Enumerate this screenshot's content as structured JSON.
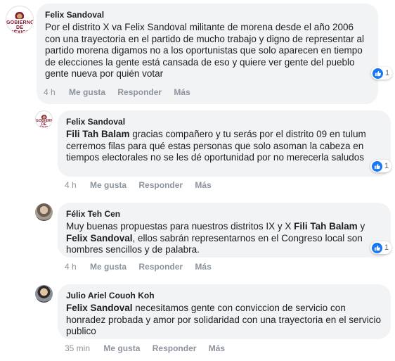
{
  "comments": [
    {
      "author": "Felix Sandoval",
      "avatar_text": "GOBIERNO DE MÉXICO",
      "text": "Por el distrito X va Felix Sandoval militante de morena desde el año 2006 con una trayectoria en el partido de mucho trabajo y digno de representar al partido morena digamos no a los oportunistas que solo aparecen en tiempo de elecciones la gente está cansada de eso y quiere ver gente del pueblo gente nueva por quién votar",
      "reaction_count": "1",
      "time": "4 h",
      "like_label": "Me gusta",
      "reply_label": "Responder",
      "more_label": "Más"
    },
    {
      "author": "Felix Sandoval",
      "avatar_text": "GOBIERNO DE MÉXICO",
      "mention": "Fili Tah Balam",
      "text": " gracias compañero y tu serás por el distrito 09 en tulum cerremos filas para qué estas personas que solo asoman la cabeza en tiempos electorales no se les dé oportunidad por no merecerla saludos",
      "reaction_count": "1",
      "time": "4 h",
      "like_label": "Me gusta",
      "reply_label": "Responder",
      "more_label": "Más"
    },
    {
      "author": "Félix Teh Cen",
      "text_a": "Muy buenas propuestas para nuestros distritos IX y X ",
      "mention_a": "Fili Tah Balam",
      "text_b": " y ",
      "mention_b": "Felix Sandoval",
      "text_c": ", ellos sabrán representarnos en el Congreso local son hombres sencillos y de palabra.",
      "reaction_count": "1",
      "time": "4 h",
      "like_label": "Me gusta",
      "reply_label": "Responder",
      "more_label": "Más"
    },
    {
      "author": "Julio Ariel Couoh Koh",
      "mention": "Felix Sandoval",
      "text": " necesitamos gente con conviccion de servicio con honradez probada y amor por solidaridad con una trayectoria en el servicio publico",
      "time": "35 min",
      "like_label": "Me gusta",
      "reply_label": "Responder",
      "more_label": "Más"
    }
  ],
  "colors": {
    "like_blue": "#1877f2",
    "bubble": "#f2f3f5",
    "meta": "#90949c"
  },
  "icons": {
    "reaction": "like-thumb-icon"
  }
}
